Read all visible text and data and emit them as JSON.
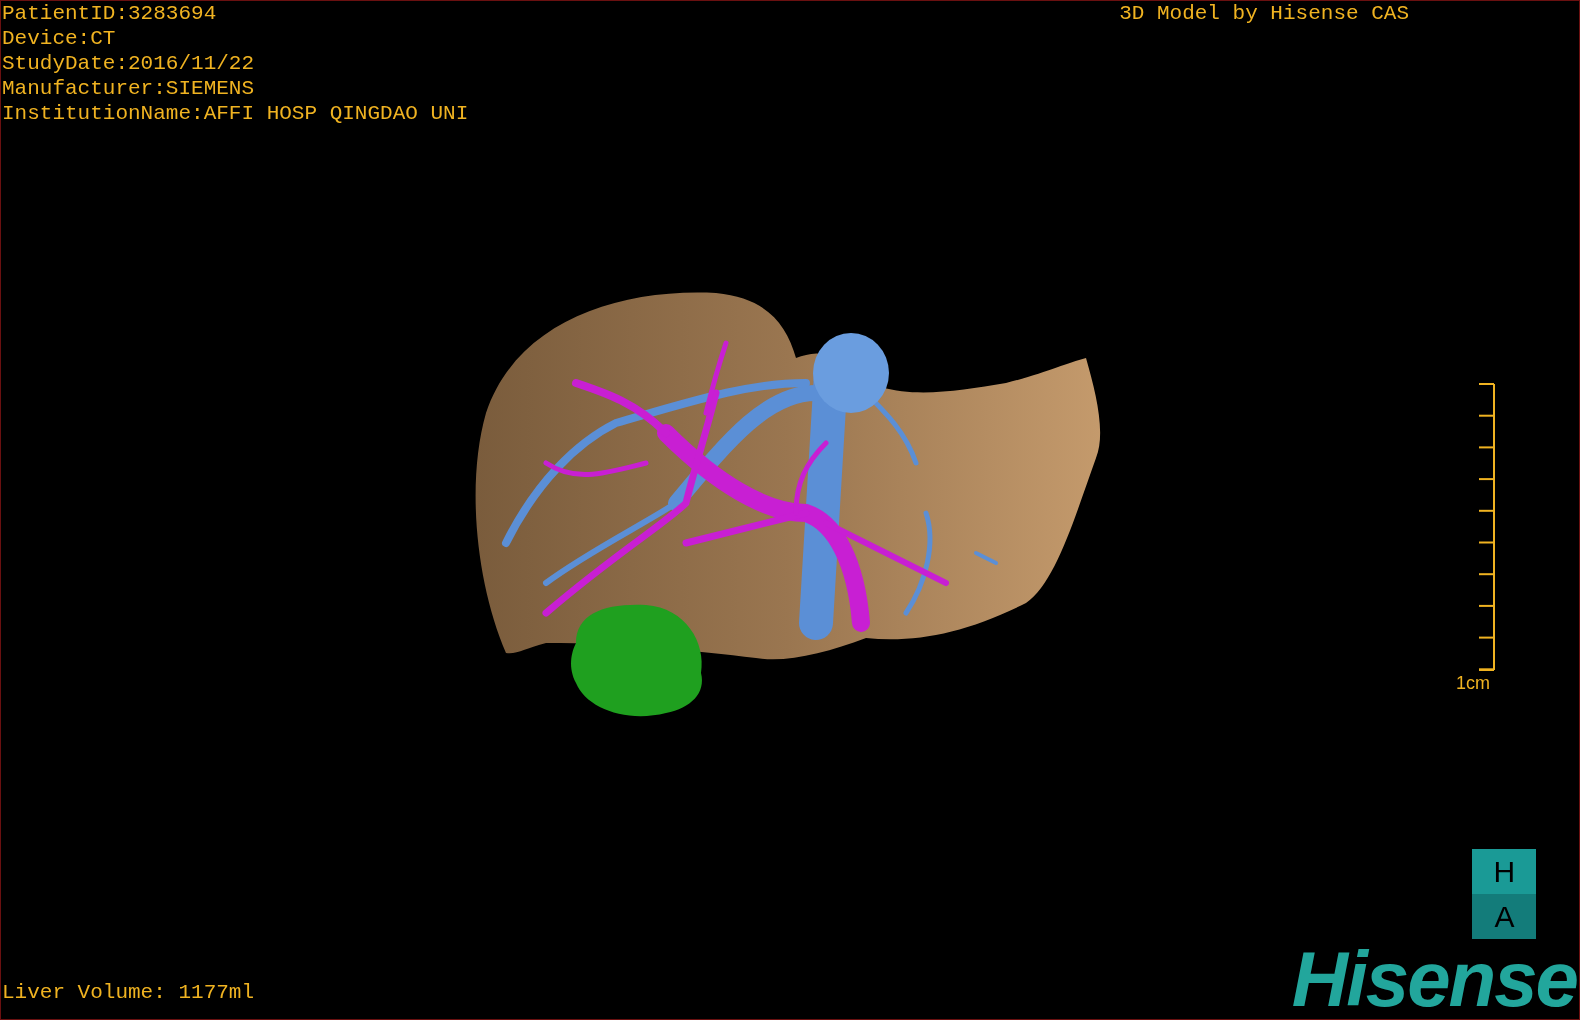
{
  "info_lines": [
    "PatientID:3283694",
    "Device:CT",
    "StudyDate:2016/11/22",
    "Manufacturer:SIEMENS",
    "InstitutionName:AFFI HOSP QINGDAO UNI"
  ],
  "title": "3D Model by Hisense CAS",
  "scale_bar": {
    "label": "1cm"
  },
  "orientation_cube": {
    "top_face": "H",
    "front_face": "A"
  },
  "liver_volume": "Liver Volume: 1177ml",
  "logo": {
    "wordmark": "Hisense"
  }
}
